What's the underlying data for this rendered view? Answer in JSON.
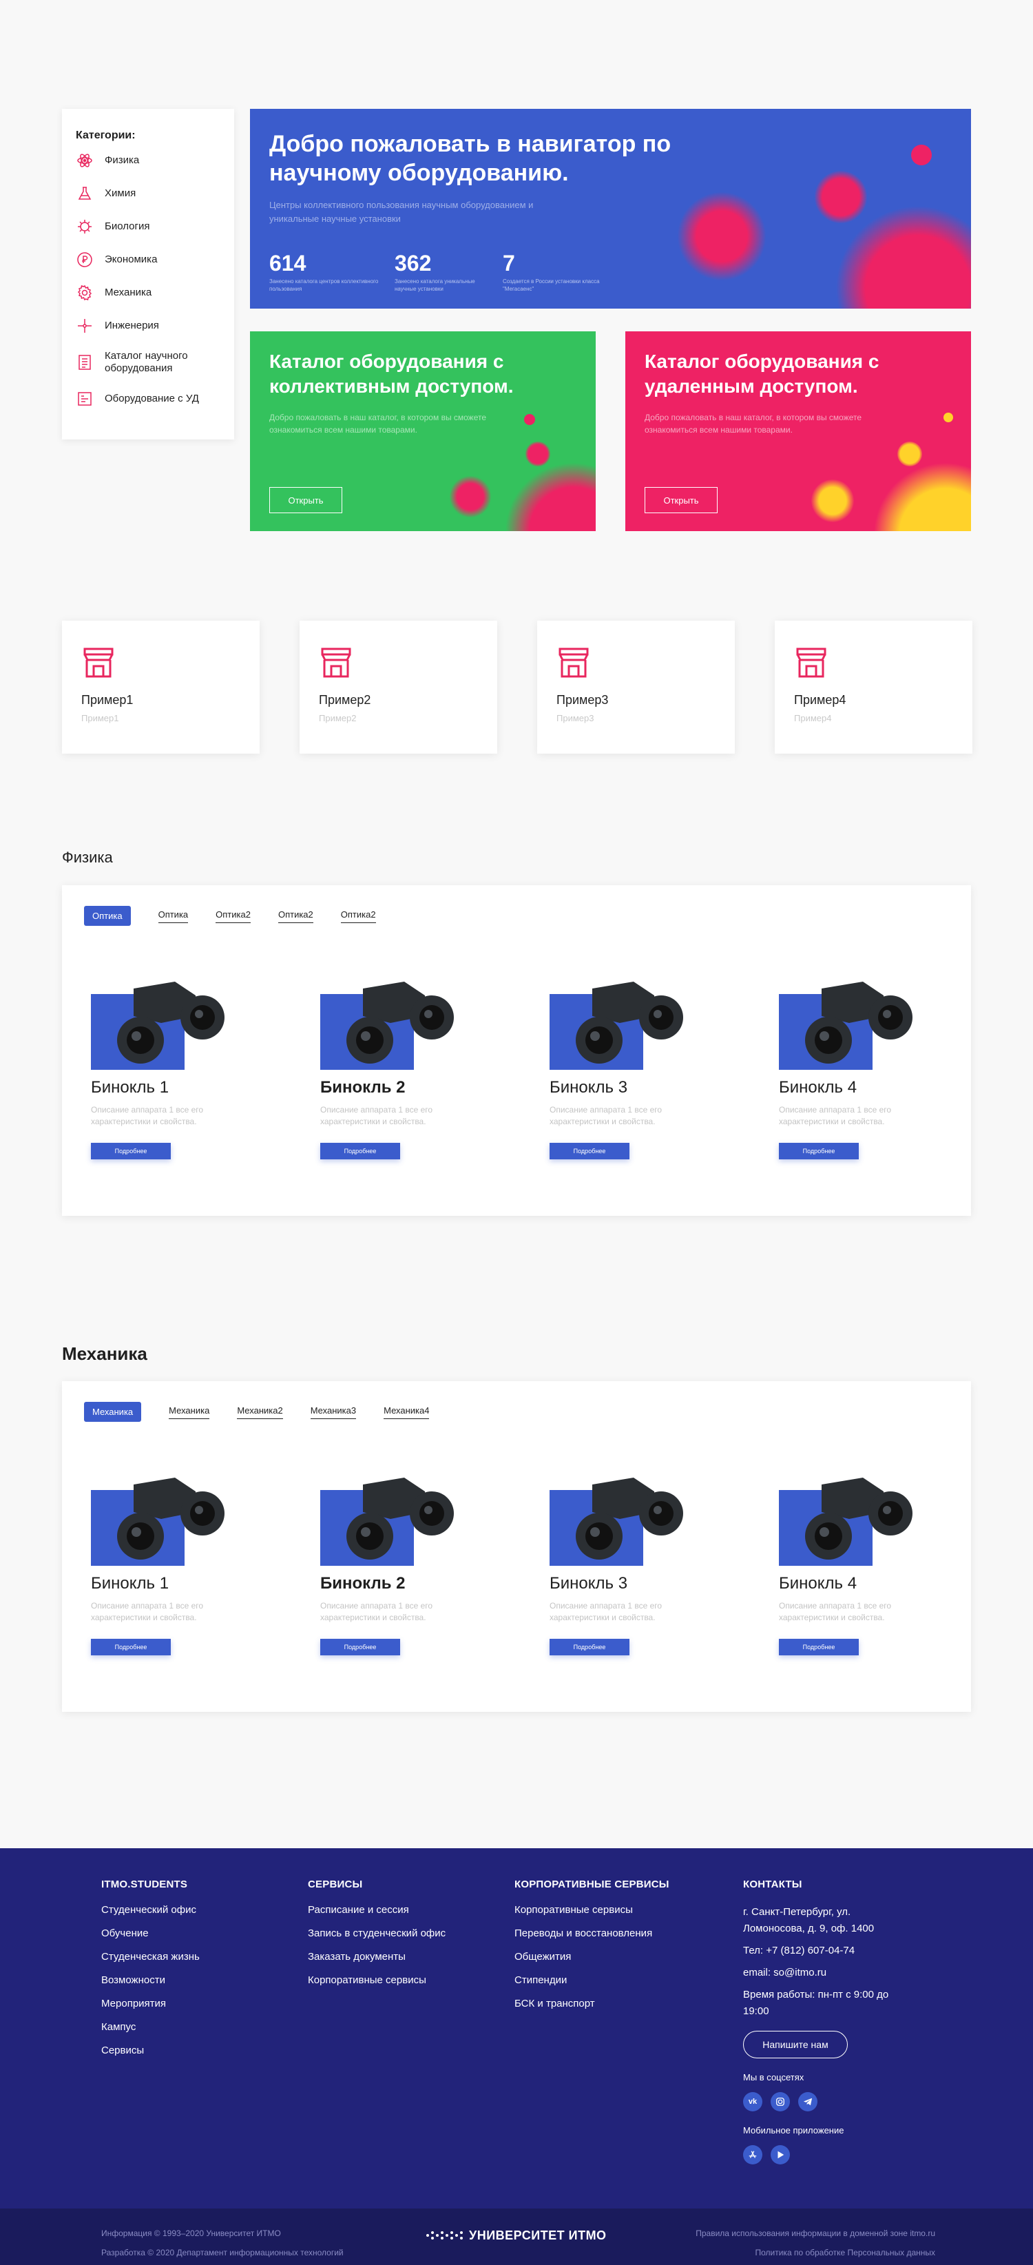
{
  "categories": {
    "title": "Категории:",
    "items": [
      {
        "label": "Физика",
        "icon": "atom-icon"
      },
      {
        "label": "Химия",
        "icon": "flask-icon"
      },
      {
        "label": "Биология",
        "icon": "virus-icon"
      },
      {
        "label": "Экономика",
        "icon": "ruble-icon"
      },
      {
        "label": "Механика",
        "icon": "gear-icon"
      },
      {
        "label": "Инженерия",
        "icon": "puzzle-icon"
      },
      {
        "label": "Каталог научного оборудования",
        "icon": "list-icon"
      },
      {
        "label": "Оборудование с УД",
        "icon": "remote-icon"
      }
    ]
  },
  "hero": {
    "title": "Добро пожаловать в навигатор по научному оборудованию.",
    "subtitle": "Центры коллективного пользования научным оборудованием и уникальные научные установки",
    "stats": [
      {
        "num": "614",
        "label": "Занесено каталога центров коллективного пользования"
      },
      {
        "num": "362",
        "label": "Занесено каталога уникальные научные установки"
      },
      {
        "num": "7",
        "label": "Создается в России установки класса \"Мегасаенс\""
      }
    ]
  },
  "catalog_cards": [
    {
      "title": "Каталог оборудования с коллективным доступом.",
      "desc": "Добро пожаловать в наш каталог, в котором вы сможете ознакомиться всем нашими товарами.",
      "button": "Открыть"
    },
    {
      "title": "Каталог оборудования с удаленным доступом.",
      "desc": "Добро пожаловать в наш каталог, в котором вы сможете ознакомиться всем нашими товарами.",
      "button": "Открыть"
    }
  ],
  "examples": [
    {
      "title": "Пример1",
      "sub": "Пример1"
    },
    {
      "title": "Пример2",
      "sub": "Пример2"
    },
    {
      "title": "Пример3",
      "sub": "Пример3"
    },
    {
      "title": "Пример4",
      "sub": "Пример4"
    }
  ],
  "physics": {
    "title": "Физика",
    "tabs": [
      "Оптика",
      "Оптика",
      "Оптика2",
      "Оптика2",
      "Оптика2"
    ],
    "products": [
      {
        "name": "Бинокль 1",
        "desc": "Описание аппарата 1 все его характеристики и свойства.",
        "button": "Подробнее"
      },
      {
        "name": "Бинокль 2",
        "desc": "Описание аппарата 1 все его характеристики и свойства.",
        "button": "Подробнее"
      },
      {
        "name": "Бинокль 3",
        "desc": "Описание аппарата 1 все его характеристики и свойства.",
        "button": "Подробнее"
      },
      {
        "name": "Бинокль 4",
        "desc": "Описание аппарата 1 все его характеристики и свойства.",
        "button": "Подробнее"
      }
    ]
  },
  "mechanics": {
    "title": "Механика",
    "tabs": [
      "Механика",
      "Механика",
      "Механика2",
      "Механика3",
      "Механика4"
    ],
    "products": [
      {
        "name": "Бинокль 1",
        "desc": "Описание аппарата 1 все его характеристики и свойства.",
        "button": "Подробнее"
      },
      {
        "name": "Бинокль 2",
        "desc": "Описание аппарата 1 все его характеристики и свойства.",
        "button": "Подробнее"
      },
      {
        "name": "Бинокль 3",
        "desc": "Описание аппарата 1 все его характеристики и свойства.",
        "button": "Подробнее"
      },
      {
        "name": "Бинокль 4",
        "desc": "Описание аппарата 1 все его характеристики и свойства.",
        "button": "Подробнее"
      }
    ]
  },
  "footer": {
    "students": {
      "title": "ITMO.STUDENTS",
      "links": [
        "Студенческий офис",
        "Обучение",
        "Студенческая жизнь",
        "Возможности",
        "Мероприятия",
        "Кампус",
        "Сервисы"
      ]
    },
    "services": {
      "title": "СЕРВИСЫ",
      "links": [
        "Расписание и сессия",
        "Запись в студенческий офис",
        "Заказать документы",
        "Корпоративные сервисы"
      ]
    },
    "corporate": {
      "title": "КОРПОРАТИВНЫЕ СЕРВИСЫ",
      "links": [
        "Корпоративные сервисы",
        "Переводы и восстановления",
        "Общежития",
        "Стипендии",
        "БСК и транспорт"
      ]
    },
    "contacts": {
      "title": "КОНТАКТЫ",
      "address": "г. Санкт-Петербург, ул. Ломоносова, д. 9, оф. 1400",
      "phone": "Тел: +7 (812) 607-04-74",
      "email": "email: so@itmo.ru",
      "hours": "Время работы: пн-пт с 9:00 до 19:00",
      "write_button": "Напишите нам",
      "social_title": "Мы в соцсетях",
      "social": [
        "vk",
        "instagram",
        "telegram"
      ],
      "app_title": "Мобильное приложение",
      "apps": [
        "app-store",
        "google-play"
      ]
    }
  },
  "bottom": {
    "info1": "Информация © 1993–2020 Университет ИТМО",
    "info2": "Разработка © 2020 Департамент информационных технологий",
    "logo": "УНИВЕРСИТЕТ ИТМО",
    "link1": "Правила использования информации в доменной зоне itmo.ru",
    "link2": "Политика по обработке Персональных данных"
  },
  "colors": {
    "accent_blue": "#3b5ccc",
    "pink": "#ee2264",
    "green": "#34c25d",
    "footer": "#22237a"
  }
}
